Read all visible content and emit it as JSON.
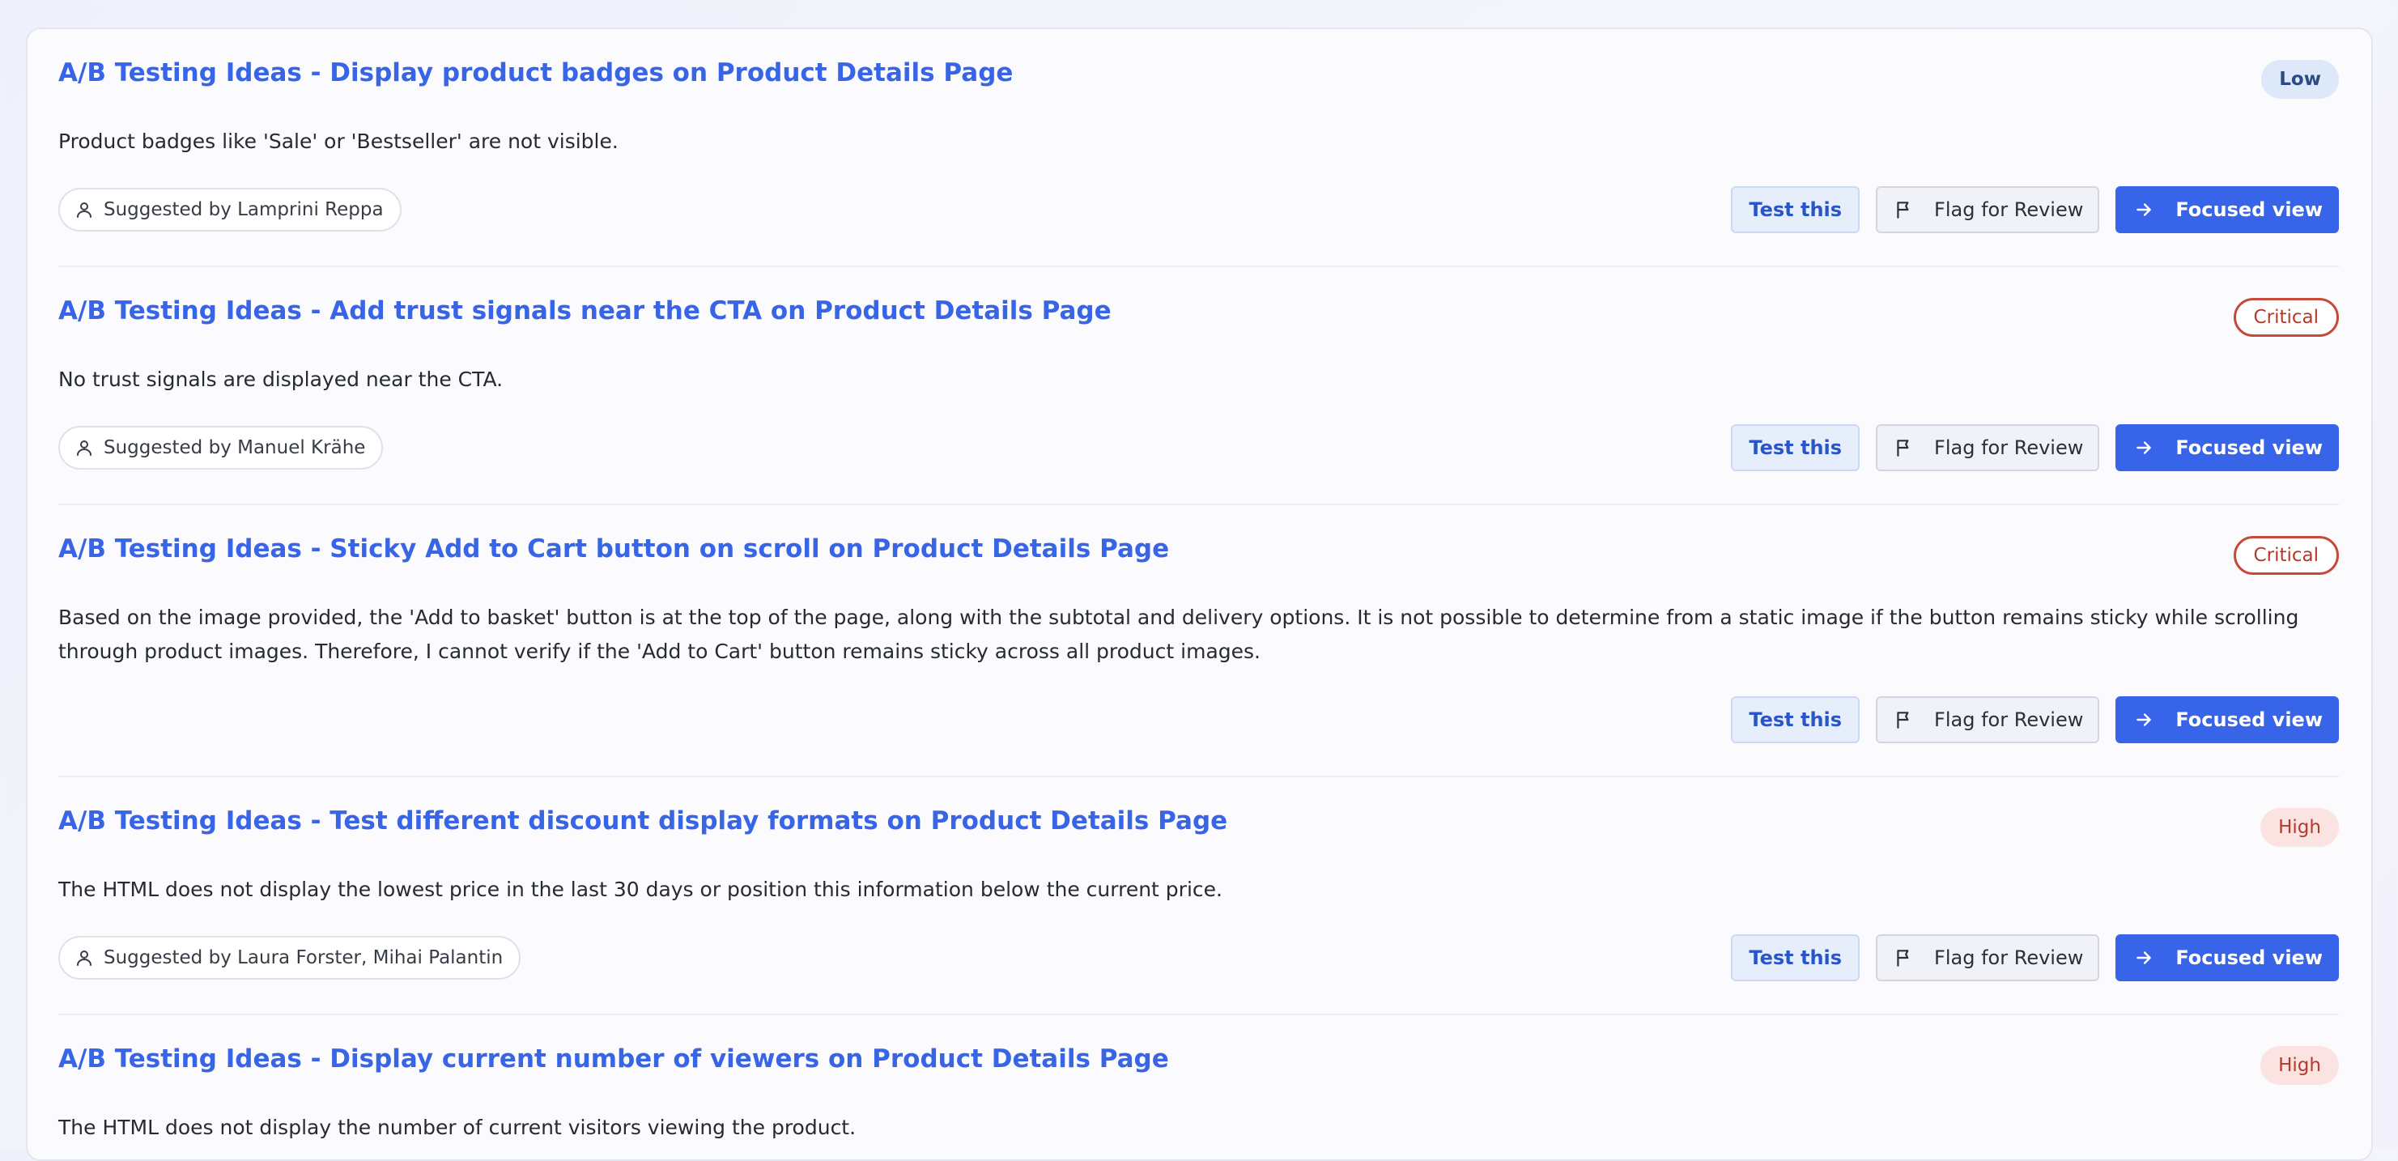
{
  "actions": {
    "test_label": "Test this",
    "flag_label": "Flag for Review",
    "focus_label": "Focused view"
  },
  "icons": {
    "suggester": "user-icon",
    "flag": "flag-icon",
    "focus": "arrow-right-icon"
  },
  "colors": {
    "accent": "#3864ea",
    "title": "#3864e6",
    "critical": "#c64a3a",
    "high_bg": "#fbe3e1",
    "low_bg": "#dde8f8"
  },
  "ideas": [
    {
      "title": "A/B Testing Ideas - Display product badges on Product Details Page",
      "priority": "Low",
      "description": "Product badges like 'Sale' or 'Bestseller' are not visible.",
      "suggested_by": "Suggested by Lamprini Reppa"
    },
    {
      "title": "A/B Testing Ideas - Add trust signals near the CTA on Product Details Page",
      "priority": "Critical",
      "description": "No trust signals are displayed near the CTA.",
      "suggested_by": "Suggested by Manuel Krähe"
    },
    {
      "title": "A/B Testing Ideas - Sticky Add to Cart button on scroll on Product Details Page",
      "priority": "Critical",
      "description": "Based on the image provided, the 'Add to basket' button is at the top of the page, along with the subtotal and delivery options. It is not possible to determine from a static image if the button remains sticky while scrolling through product images. Therefore, I cannot verify if the 'Add to Cart' button remains sticky across all product images.",
      "suggested_by": ""
    },
    {
      "title": "A/B Testing Ideas - Test different discount display formats on Product Details Page",
      "priority": "High",
      "description": "The HTML does not display the lowest price in the last 30 days or position this information below the current price.",
      "suggested_by": "Suggested by Laura Forster, Mihai Palantin"
    },
    {
      "title": "A/B Testing Ideas - Display current number of viewers on Product Details Page",
      "priority": "High",
      "description": "The HTML does not display the number of current visitors viewing the product.",
      "suggested_by": ""
    }
  ]
}
